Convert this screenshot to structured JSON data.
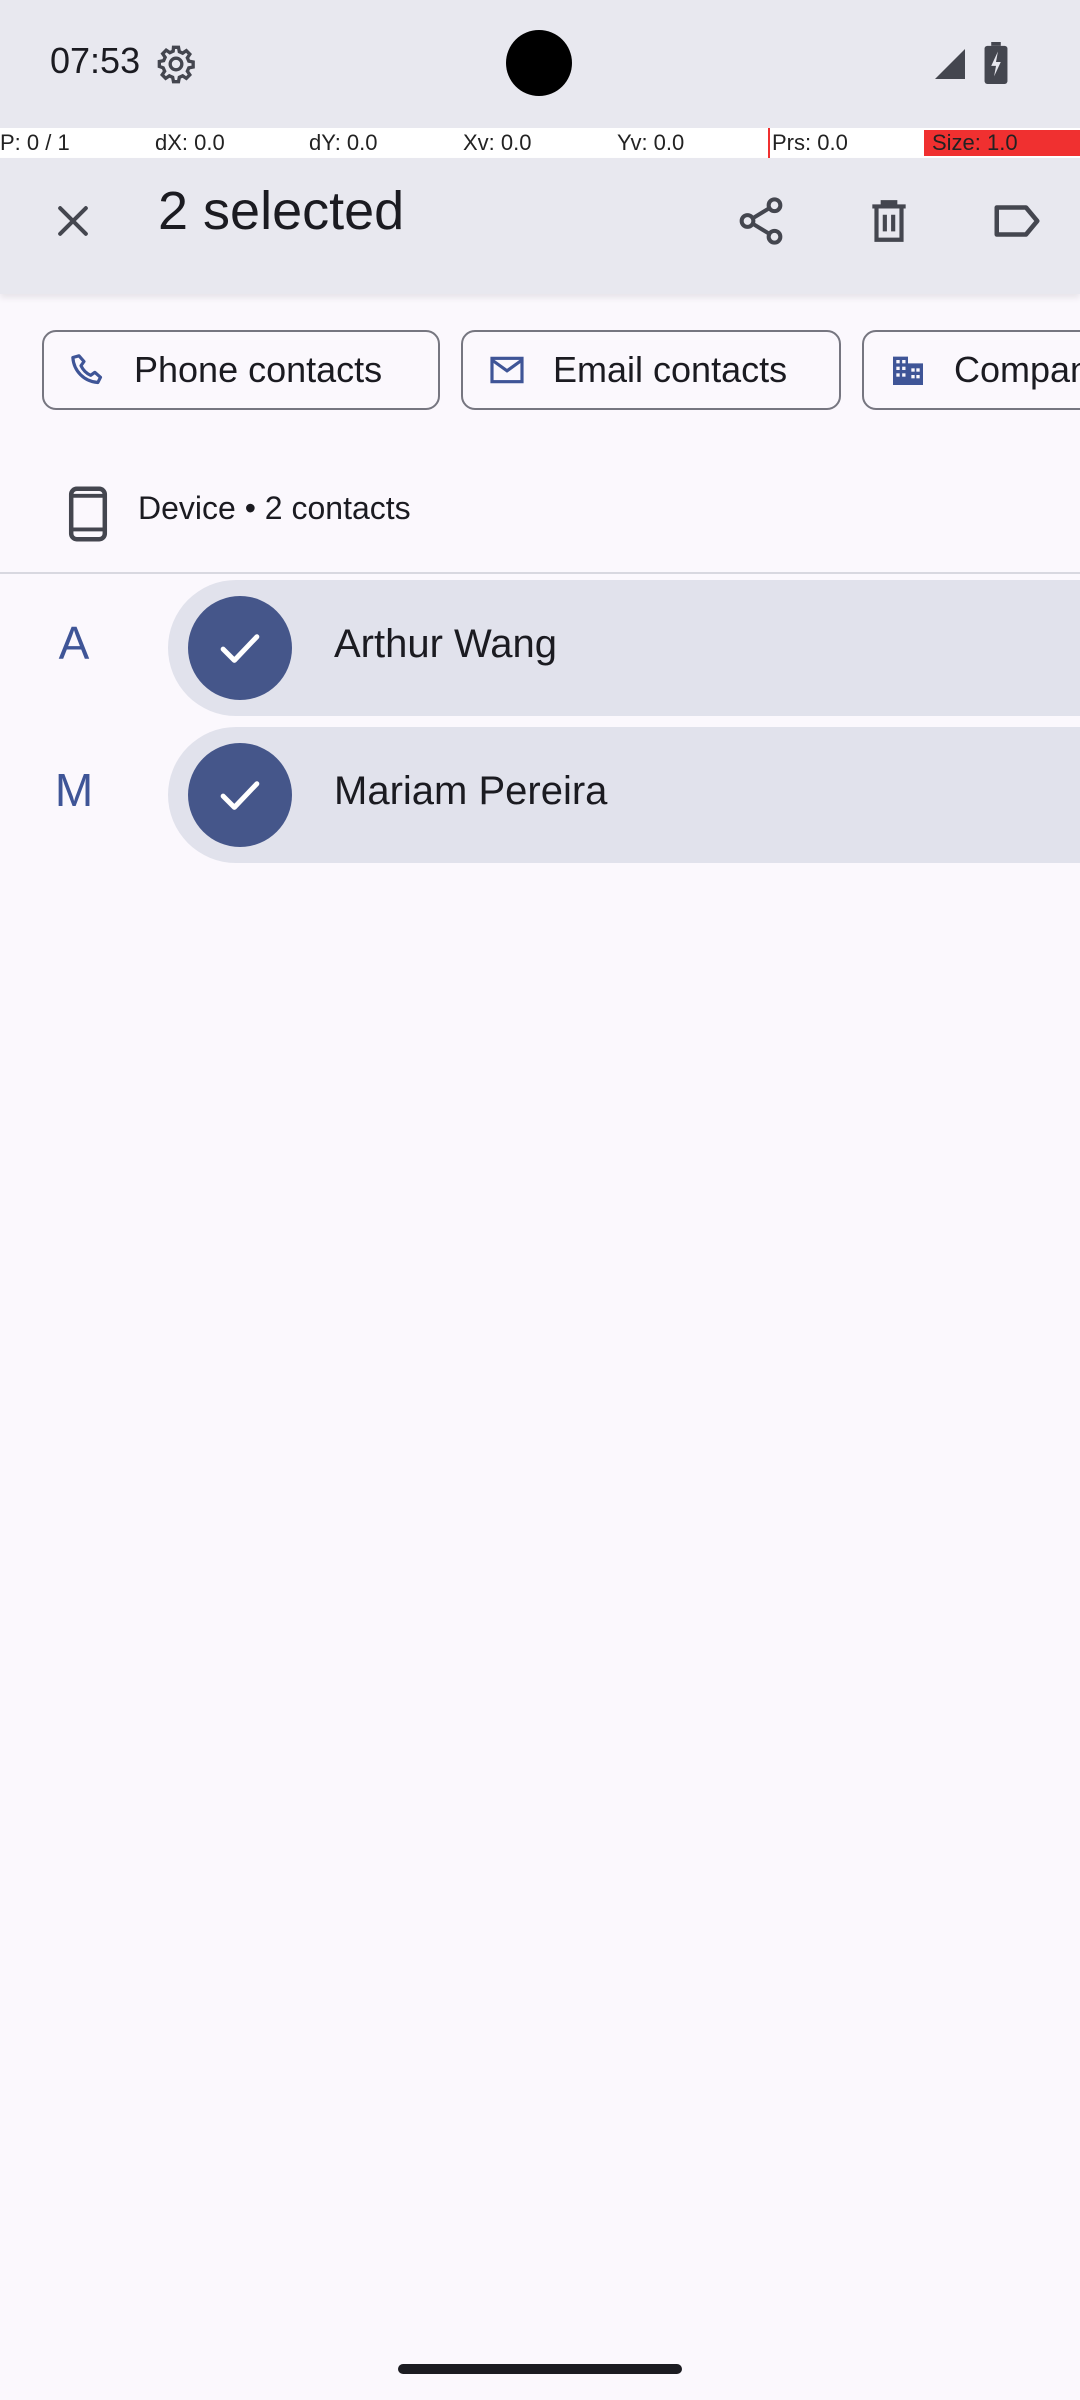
{
  "status_bar": {
    "time": "07:53",
    "settings_icon": "gear-icon",
    "signal_icon": "signal-icon",
    "battery_icon": "battery-charging-icon"
  },
  "debug_overlay": {
    "pointer": "P: 0 / 1",
    "dx": "dX: 0.0",
    "dy": "dY: 0.0",
    "xv": "Xv: 0.0",
    "yv": "Yv: 0.0",
    "prs": "Prs: 0.0",
    "size": "Size: 1.0"
  },
  "action_bar": {
    "title": "2 selected",
    "close_icon": "close-icon",
    "share_icon": "share-icon",
    "delete_icon": "delete-icon",
    "label_icon": "label-icon"
  },
  "filters": {
    "chips": [
      {
        "label": "Phone contacts",
        "icon": "phone-icon"
      },
      {
        "label": "Email contacts",
        "icon": "email-icon"
      },
      {
        "label": "Company",
        "icon": "company-icon"
      }
    ]
  },
  "account": {
    "label": "Device • 2 contacts",
    "icon": "device-phone-icon"
  },
  "contacts": [
    {
      "section": "A",
      "name": "Arthur Wang",
      "selected": true
    },
    {
      "section": "M",
      "name": "Mariam Pereira",
      "selected": true
    }
  ],
  "colors": {
    "accent": "#45568a",
    "section_letter": "#3f5597",
    "selected_row_bg": "#e1e2ec",
    "app_bar_bg": "#e8e8ef",
    "page_bg": "#fbf8fd"
  }
}
